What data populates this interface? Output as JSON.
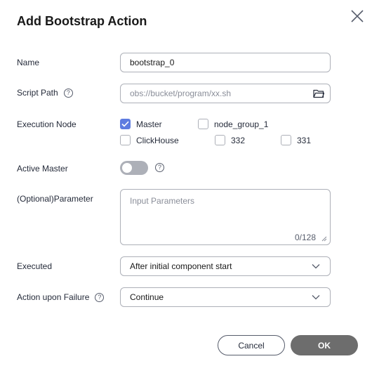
{
  "dialog": {
    "title": "Add Bootstrap Action",
    "close_icon": "close-icon"
  },
  "form": {
    "name": {
      "label": "Name",
      "value": "bootstrap_0"
    },
    "script_path": {
      "label": "Script Path",
      "help": "?",
      "placeholder": "obs://bucket/program/xx.sh",
      "icon": "folder-icon"
    },
    "execution_node": {
      "label": "Execution Node",
      "options": [
        {
          "label": "Master",
          "checked": true
        },
        {
          "label": "node_group_1",
          "checked": false
        },
        {
          "label": "ClickHouse",
          "checked": false
        },
        {
          "label": "332",
          "checked": false
        },
        {
          "label": "331",
          "checked": false
        }
      ]
    },
    "active_master": {
      "label": "Active Master",
      "enabled": false,
      "help": "?"
    },
    "parameter": {
      "label": "(Optional)Parameter",
      "placeholder": "Input Parameters",
      "counter": "0/128"
    },
    "executed": {
      "label": "Executed",
      "value": "After initial component start"
    },
    "action_upon_failure": {
      "label": "Action upon Failure",
      "help": "?",
      "value": "Continue"
    }
  },
  "footer": {
    "cancel_label": "Cancel",
    "ok_label": "OK"
  },
  "colors": {
    "accent": "#5e7ce0",
    "ok_button": "#6d6d6d",
    "border": "#adb0b8"
  }
}
